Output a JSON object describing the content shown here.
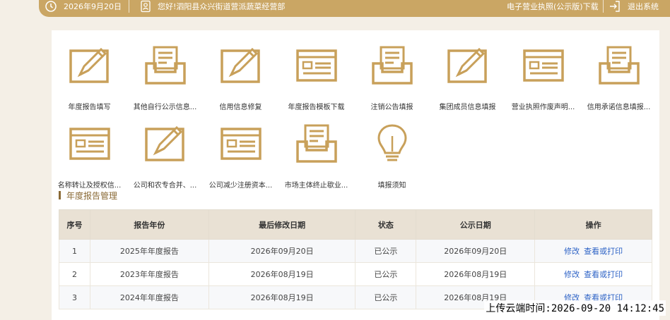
{
  "topbar": {
    "date": "2026年9月20日",
    "greeting": "您好!泗阳县众兴街道营派蔬菜经营部",
    "license_download": "电子营业执照(公示版)下载",
    "logout": "退出系统"
  },
  "tiles": [
    {
      "label": "年度报告填写",
      "icon": "pencil-doc-icon"
    },
    {
      "label": "其他自行公示信息...",
      "icon": "inbox-doc-icon"
    },
    {
      "label": "信用信息修复",
      "icon": "pencil-doc-icon"
    },
    {
      "label": "年度报告模板下载",
      "icon": "form-doc-icon"
    },
    {
      "label": "注销公告填报",
      "icon": "inbox-doc-icon"
    },
    {
      "label": "集团成员信息填报",
      "icon": "pencil-doc-icon"
    },
    {
      "label": "营业执照作废声明...",
      "icon": "form-doc-icon"
    },
    {
      "label": "信用承诺信息填报...",
      "icon": "inbox-doc-icon"
    },
    {
      "label": "名称转让及授权信...",
      "icon": "form-doc-icon"
    },
    {
      "label": "公司和农专合并、...",
      "icon": "pencil-doc-icon"
    },
    {
      "label": "公司减少注册资本...",
      "icon": "form-doc-icon"
    },
    {
      "label": "市场主体终止歇业...",
      "icon": "inbox-doc-icon"
    },
    {
      "label": "填报须知",
      "icon": "lightbulb-icon"
    }
  ],
  "section": {
    "title": "年度报告管理"
  },
  "table": {
    "headers": [
      "序号",
      "报告年份",
      "最后修改日期",
      "状态",
      "公示日期",
      "操作"
    ],
    "rows": [
      {
        "no": "1",
        "year": "2025年年度报告",
        "modified": "2026年09月20日",
        "status": "已公示",
        "published": "2026年09月20日",
        "edit": "修改",
        "view": "查看或打印"
      },
      {
        "no": "2",
        "year": "2023年年度报告",
        "modified": "2026年08月19日",
        "status": "已公示",
        "published": "2026年08月19日",
        "edit": "修改",
        "view": "查看或打印"
      },
      {
        "no": "3",
        "year": "2024年年度报告",
        "modified": "2026年08月19日",
        "status": "已公示",
        "published": "2026年08月19日",
        "edit": "修改",
        "view": "查看或打印"
      }
    ]
  },
  "upload_stamp": "上传云端时间:2026-09-20 14:12:45",
  "colors": {
    "gold": "#caa664",
    "icon": "#c8a05a",
    "link": "#2e63c6",
    "header_bg": "#e9e1d4"
  }
}
